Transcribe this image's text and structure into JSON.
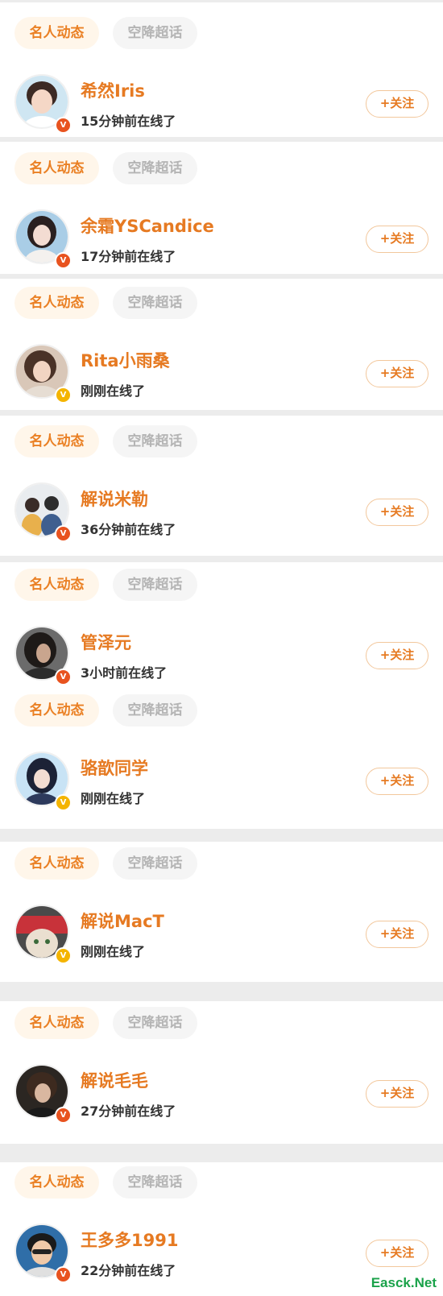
{
  "tabs": {
    "primary": "名人动态",
    "secondary": "空降超话"
  },
  "follow_label": "+关注",
  "verified_badge": "V",
  "colors": {
    "accent": "#e67a22",
    "tag_primary_bg": "#fff6ea",
    "tag_secondary_bg": "#f5f5f5",
    "badge_orange": "#e8531f",
    "badge_gold": "#f4b400",
    "divider": "#ececec"
  },
  "users": [
    {
      "name": "希然Iris",
      "status": "15分钟前在线了",
      "badge": "orange"
    },
    {
      "name": "余霜YSCandice",
      "status": "17分钟前在线了",
      "badge": "orange"
    },
    {
      "name": "Rita小雨桑",
      "status": "刚刚在线了",
      "badge": "gold"
    },
    {
      "name": "解说米勒",
      "status": "36分钟前在线了",
      "badge": "orange"
    },
    {
      "name": "管泽元",
      "status": "3小时前在线了",
      "badge": "orange"
    },
    {
      "name": "骆歆同学",
      "status": "刚刚在线了",
      "badge": "gold"
    },
    {
      "name": "解说MacT",
      "status": "刚刚在线了",
      "badge": "gold"
    },
    {
      "name": "解说毛毛",
      "status": "27分钟前在线了",
      "badge": "orange"
    },
    {
      "name": "王多多1991",
      "status": "22分钟前在线了",
      "badge": "orange"
    }
  ],
  "watermark": "Easck.Net"
}
